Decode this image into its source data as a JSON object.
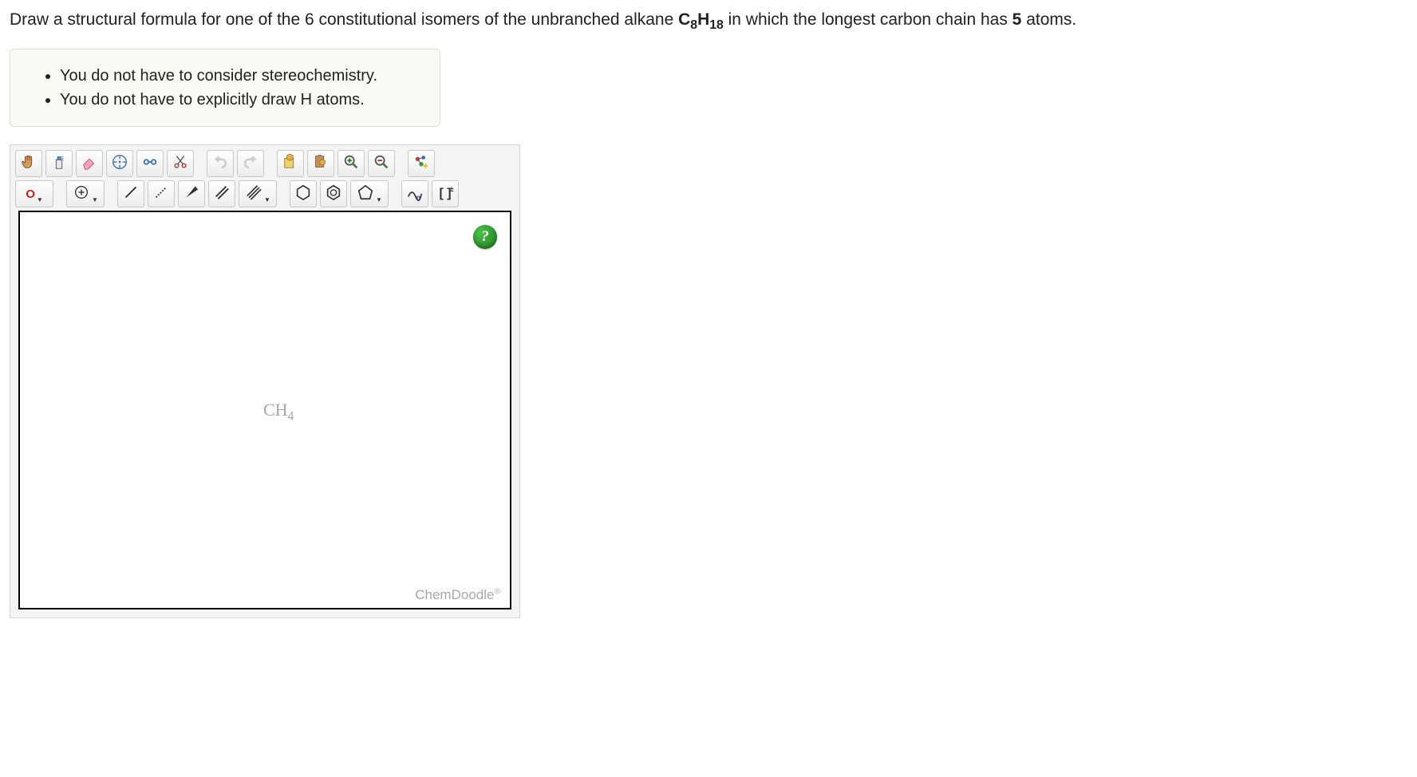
{
  "question": {
    "prefix": "Draw a structural formula for one of the 6 constitutional isomers of the unbranched alkane ",
    "formula_base": "C",
    "formula_sub1": "8",
    "formula_mid": "H",
    "formula_sub2": "18",
    "middle": " in which the longest carbon chain has ",
    "bold_num": "5",
    "suffix": " atoms."
  },
  "notes": [
    "You do not have to consider stereochemistry.",
    "You do not have to explicitly draw H atoms."
  ],
  "toolbar_row1_icons": [
    "hand-icon",
    "spray-icon",
    "eraser-icon",
    "move-icon",
    "lasso-icon",
    "cut-icon",
    "undo-icon",
    "redo-icon",
    "copy-struct-icon",
    "paste-struct-icon",
    "zoom-in-icon",
    "zoom-out-icon",
    "clean-icon"
  ],
  "atom_label": "O",
  "canvas": {
    "placeholder_base": "CH",
    "placeholder_sub": "4",
    "help": "?",
    "branding": "ChemDoodle",
    "branding_mark": "®"
  }
}
